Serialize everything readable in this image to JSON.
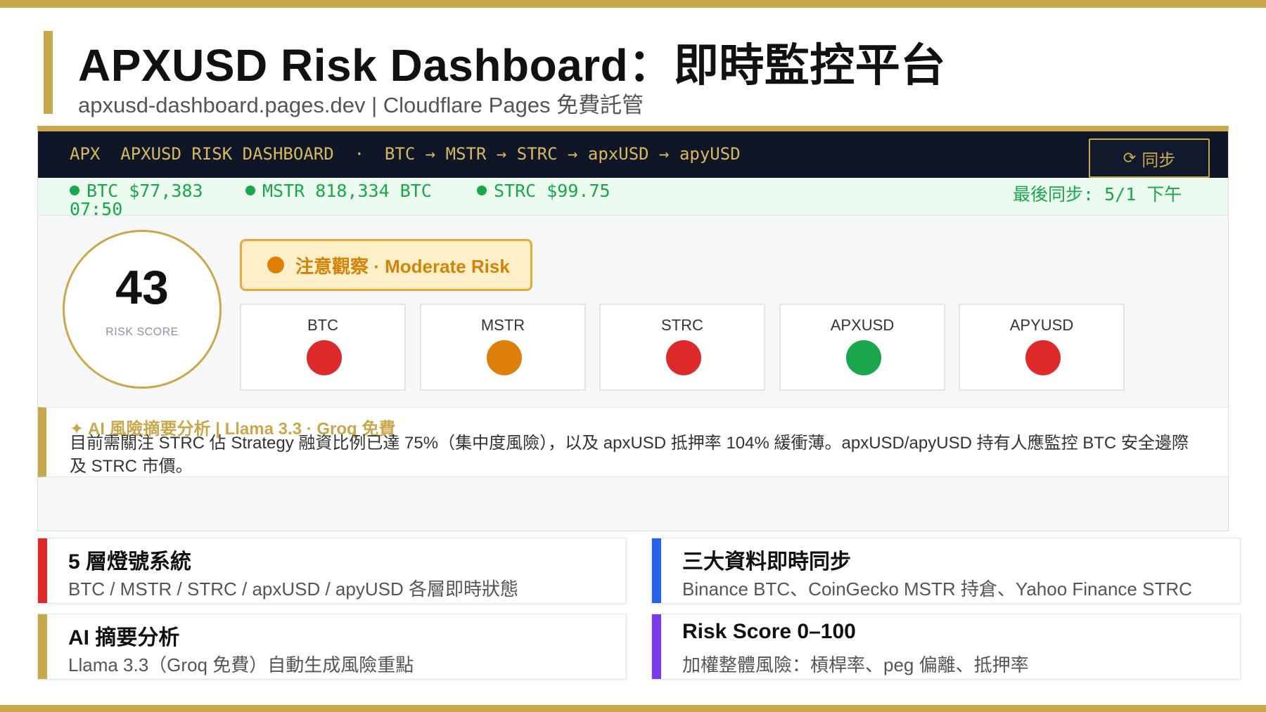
{
  "header": {
    "title": "APXUSD Risk Dashboard：即時監控平台",
    "subtitle": "apxusd-dashboard.pages.dev | Cloudflare Pages 免費託管"
  },
  "dashboard": {
    "topbar_text": "APX  APXUSD RISK DASHBOARD  ·  BTC → MSTR → STRC → apxUSD → apyUSD",
    "sync_icon": "refresh-icon",
    "sync_label": "同步",
    "status": {
      "btc": "BTC $77,383",
      "mstr": "MSTR 818,334 BTC",
      "strc": "STRC $99.75",
      "last_sync": "最後同步: 5/1 下午",
      "last_sync_time": "07:50"
    },
    "score": {
      "value": "43",
      "label": "RISK SCORE"
    },
    "risk_badge": "注意觀察 · Moderate Risk",
    "layers": [
      {
        "name": "BTC",
        "color": "#de2a2a"
      },
      {
        "name": "MSTR",
        "color": "#de7f0a"
      },
      {
        "name": "STRC",
        "color": "#de2a2a"
      },
      {
        "name": "APXUSD",
        "color": "#1aa64a"
      },
      {
        "name": "APYUSD",
        "color": "#de2a2a"
      }
    ],
    "ai": {
      "heading": "✦ AI 風險摘要分析 | Llama 3.3 · Groq 免費",
      "text": "目前需關注 STRC 佔 Strategy 融資比例已達 75%（集中度風險），以及 apxUSD 抵押率 104% 緩衝薄。apxUSD/apyUSD 持有人應監控 BTC 安全邊際及 STRC 市價。"
    }
  },
  "features": [
    {
      "title": "5 層燈號系統",
      "desc": "BTC / MSTR / STRC / apxUSD / apyUSD 各層即時狀態",
      "color": "#de2a2a"
    },
    {
      "title": "三大資料即時同步",
      "desc": "Binance BTC、CoinGecko MSTR 持倉、Yahoo Finance STRC",
      "color": "#2563eb"
    },
    {
      "title": "AI 摘要分析",
      "desc": "Llama 3.3（Groq 免費）自動生成風險重點",
      "color": "#c9a84c"
    },
    {
      "title": "Risk Score 0–100",
      "desc": "加權整體風險：槓桿率、peg 偏離、抵押率",
      "color": "#7c3aed"
    }
  ]
}
